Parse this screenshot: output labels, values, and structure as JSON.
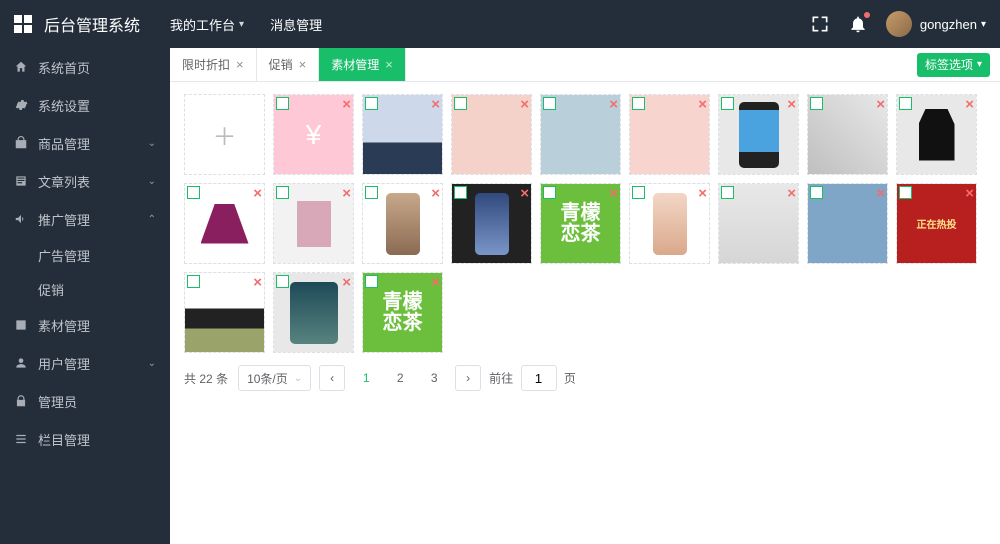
{
  "header": {
    "brand": "后台管理系统",
    "my_workbench": "我的工作台",
    "msg_mgr": "消息管理",
    "username": "gongzhen"
  },
  "sidebar": {
    "home": "系统首页",
    "settings": "系统设置",
    "goods": "商品管理",
    "articles": "文章列表",
    "promo": "推广管理",
    "promo_sub_ad": "广告管理",
    "promo_sub_sale": "促销",
    "material": "素材管理",
    "user": "用户管理",
    "admin": "管理员",
    "column": "栏目管理"
  },
  "tabs": {
    "t0": "限时折扣",
    "t1": "促销",
    "t2": "素材管理",
    "tag_select": "标签选项"
  },
  "grid": {
    "tea_text": "青檬\n恋茶",
    "promo_text": "正在热投"
  },
  "pager": {
    "total_prefix": "共",
    "total_count": "22",
    "total_suffix": "条",
    "size_label": "10条/页",
    "p1": "1",
    "p2": "2",
    "p3": "3",
    "jump_prefix": "前往",
    "jump_value": "1",
    "jump_suffix": "页"
  }
}
